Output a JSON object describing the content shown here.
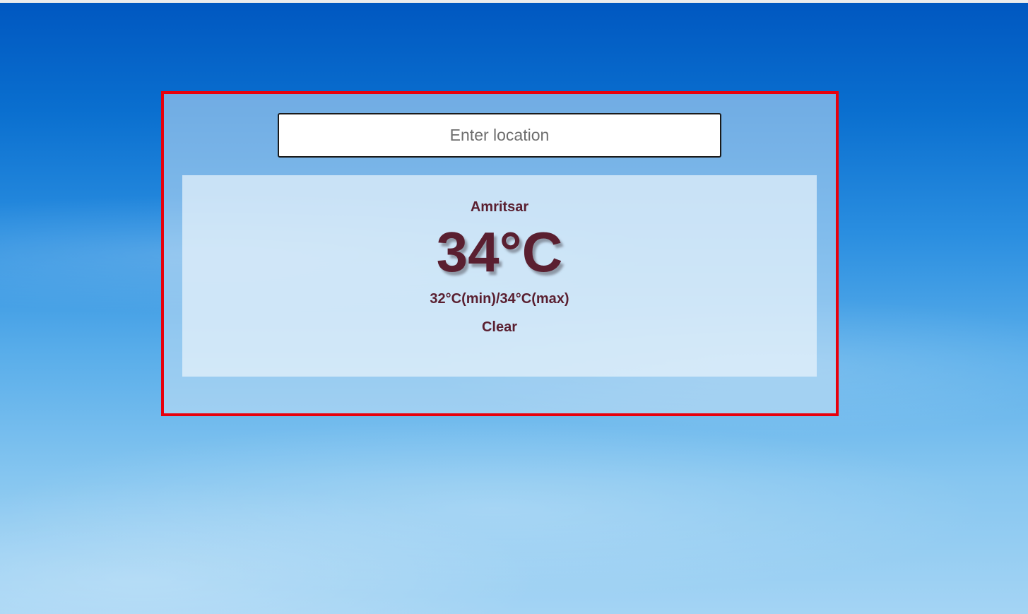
{
  "search": {
    "placeholder": "Enter location",
    "value": ""
  },
  "weather": {
    "city": "Amritsar",
    "temperature": "34°C",
    "min_max": "32°C(min)/34°C(max)",
    "condition": "Clear"
  },
  "colors": {
    "panel_border": "#e8000c",
    "text": "#5a1f30",
    "sky_top": "#0057c0",
    "sky_bottom": "#a4d4f4"
  }
}
